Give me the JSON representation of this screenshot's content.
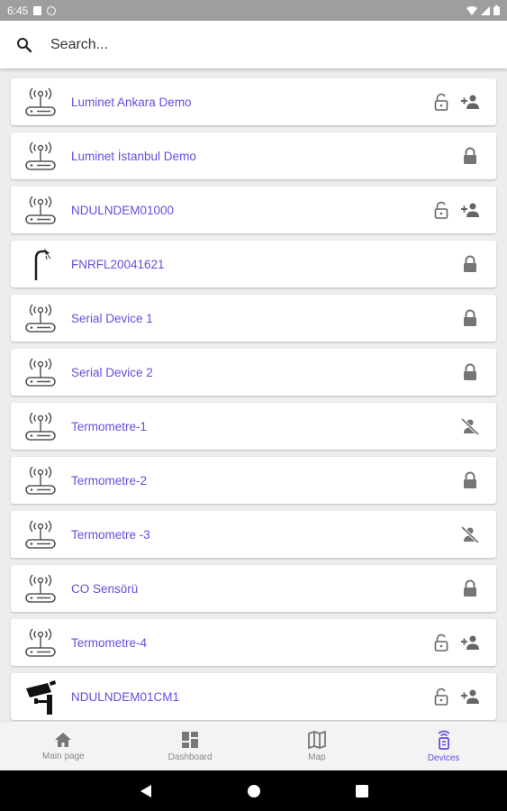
{
  "status_bar": {
    "time": "6:45"
  },
  "search": {
    "placeholder": "Search..."
  },
  "colors": {
    "accent": "#6a4ce0",
    "icon_gray": "#9e9e9e",
    "icon_dark": "#555555"
  },
  "devices": [
    {
      "name": "Luminet Ankara Demo",
      "icon": "router-icon",
      "actions": [
        "lock-open-icon",
        "person-add-icon"
      ]
    },
    {
      "name": "Luminet İstanbul Demo",
      "icon": "router-icon",
      "actions": [
        "lock-icon"
      ]
    },
    {
      "name": "NDULNDEM01000",
      "icon": "router-icon",
      "actions": [
        "lock-open-icon",
        "person-add-icon"
      ]
    },
    {
      "name": "FNRFL20041621",
      "icon": "street-light-icon",
      "actions": [
        "lock-icon"
      ]
    },
    {
      "name": "Serial Device 1",
      "icon": "router-icon",
      "actions": [
        "lock-icon"
      ]
    },
    {
      "name": "Serial Device 2",
      "icon": "router-icon",
      "actions": [
        "lock-icon"
      ]
    },
    {
      "name": "Termometre-1",
      "icon": "router-icon",
      "actions": [
        "person-off-icon"
      ]
    },
    {
      "name": "Termometre-2",
      "icon": "router-icon",
      "actions": [
        "lock-icon"
      ]
    },
    {
      "name": "Termometre -3",
      "icon": "router-icon",
      "actions": [
        "person-off-icon"
      ]
    },
    {
      "name": "CO Sensörü",
      "icon": "router-icon",
      "actions": [
        "lock-icon"
      ]
    },
    {
      "name": "Termometre-4",
      "icon": "router-icon",
      "actions": [
        "lock-open-icon",
        "person-add-icon"
      ]
    },
    {
      "name": "NDULNDEM01CM1",
      "icon": "camera-icon",
      "actions": [
        "lock-open-icon",
        "person-add-icon"
      ]
    }
  ],
  "bottom_nav": [
    {
      "label": "Main page",
      "icon": "home-icon"
    },
    {
      "label": "Dashboard",
      "icon": "dashboard-icon"
    },
    {
      "label": "Map",
      "icon": "map-icon"
    },
    {
      "label": "Devices",
      "icon": "devices-icon",
      "active": true
    }
  ]
}
